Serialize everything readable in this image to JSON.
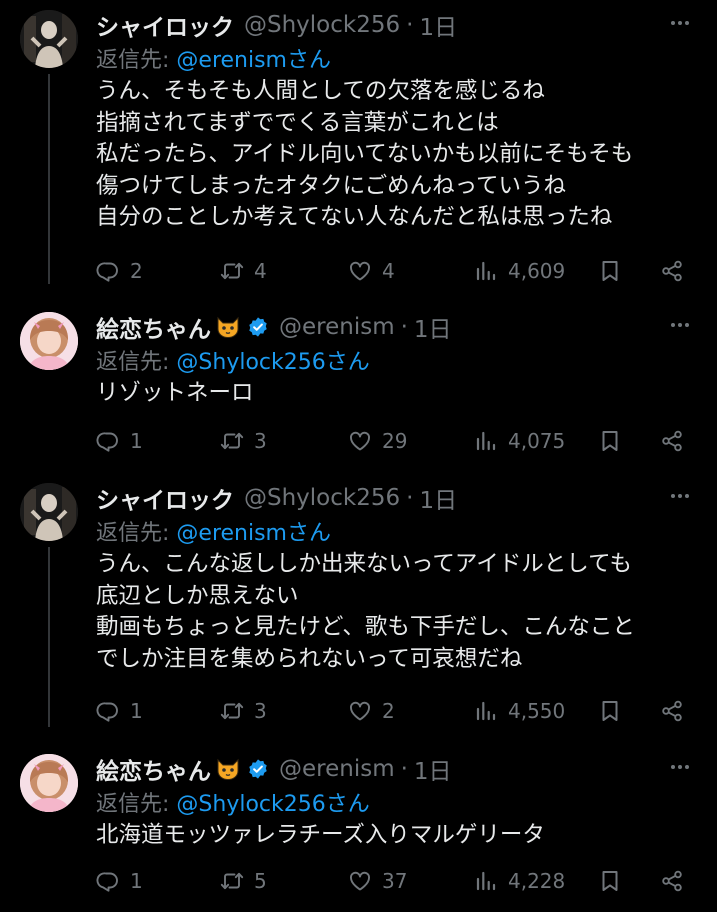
{
  "tweets": [
    {
      "author": "シャイロック",
      "handle": "@Shylock256",
      "time": "1日",
      "reply_prefix": "返信先: ",
      "reply_mention": "@erenismさん",
      "lines": [
        "うん、そもそも人間としての欠落を感じるね",
        "指摘されてまずででくる言葉がこれとは",
        "私だったら、アイドル向いてないかも以前にそもそも",
        "傷つけてしまったオタクにごめんねっていうね",
        "自分のことしか考えてない人なんだと私は思ったね"
      ],
      "replies": "2",
      "retweets": "4",
      "likes": "4",
      "views": "4,609"
    },
    {
      "author": "絵恋ちゃん",
      "handle": "@erenism",
      "time": "1日",
      "reply_prefix": "返信先: ",
      "reply_mention": "@Shylock256さん",
      "lines": [
        "リゾットネーロ"
      ],
      "replies": "1",
      "retweets": "3",
      "likes": "29",
      "views": "4,075"
    },
    {
      "author": "シャイロック",
      "handle": "@Shylock256",
      "time": "1日",
      "reply_prefix": "返信先: ",
      "reply_mention": "@erenismさん",
      "lines": [
        "うん、こんな返ししか出来ないってアイドルとしても",
        "底辺としか思えない",
        "動画もちょっと見たけど、歌も下手だし、こんなこと",
        "でしか注目を集められないって可哀想だね"
      ],
      "replies": "1",
      "retweets": "3",
      "likes": "2",
      "views": "4,550"
    },
    {
      "author": "絵恋ちゃん",
      "handle": "@erenism",
      "time": "1日",
      "reply_prefix": "返信先: ",
      "reply_mention": "@Shylock256さん",
      "lines": [
        "北海道モッツァレラチーズ入りマルゲリータ"
      ],
      "replies": "1",
      "retweets": "5",
      "likes": "37",
      "views": "4,228"
    }
  ],
  "colors": {
    "background": "#000000",
    "text": "#e7e9ea",
    "secondary": "#71767b",
    "mention": "#1d9bf0",
    "verified": "#1d9bf0",
    "divider": "#333639"
  },
  "icons": [
    "reply-icon",
    "retweet-icon",
    "like-icon",
    "views-icon",
    "bookmark-icon",
    "share-icon",
    "more-icon",
    "verified-badge-icon",
    "cat-emoji-icon"
  ]
}
